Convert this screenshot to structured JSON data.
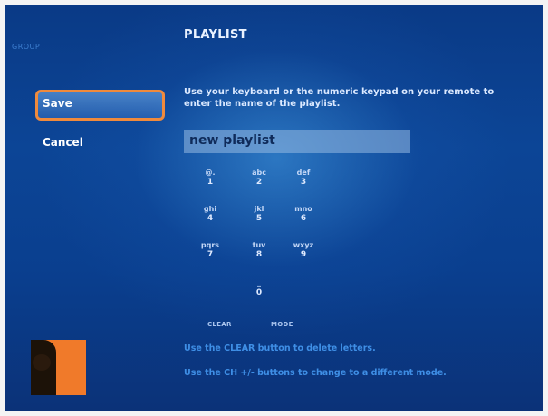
{
  "header": {
    "back_label": "GROUP",
    "title": "PLAYLIST"
  },
  "menu": {
    "save_label": "Save",
    "cancel_label": "Cancel"
  },
  "instructions": {
    "text": "Use your keyboard or the numeric keypad on your remote to enter the name of the playlist."
  },
  "name_field": {
    "value": "new playlist"
  },
  "keypad": {
    "keys": [
      {
        "letters": "@.",
        "digit": "1"
      },
      {
        "letters": "abc",
        "digit": "2"
      },
      {
        "letters": "def",
        "digit": "3"
      },
      {
        "letters": "ghi",
        "digit": "4"
      },
      {
        "letters": "jkl",
        "digit": "5"
      },
      {
        "letters": "mno",
        "digit": "6"
      },
      {
        "letters": "pqrs",
        "digit": "7"
      },
      {
        "letters": "tuv",
        "digit": "8"
      },
      {
        "letters": "wxyz",
        "digit": "9"
      }
    ],
    "zero": {
      "letters": "_",
      "digit": "0"
    },
    "clear_label": "CLEAR",
    "mode_label": "MODE"
  },
  "hints": {
    "clear_hint": "Use the CLEAR button to delete letters.",
    "mode_hint": "Use the CH +/- buttons to change to a different mode."
  },
  "colors": {
    "accent_focus": "#f08a3c",
    "background": "#0c4596",
    "hint_text": "#3f8fe6"
  }
}
